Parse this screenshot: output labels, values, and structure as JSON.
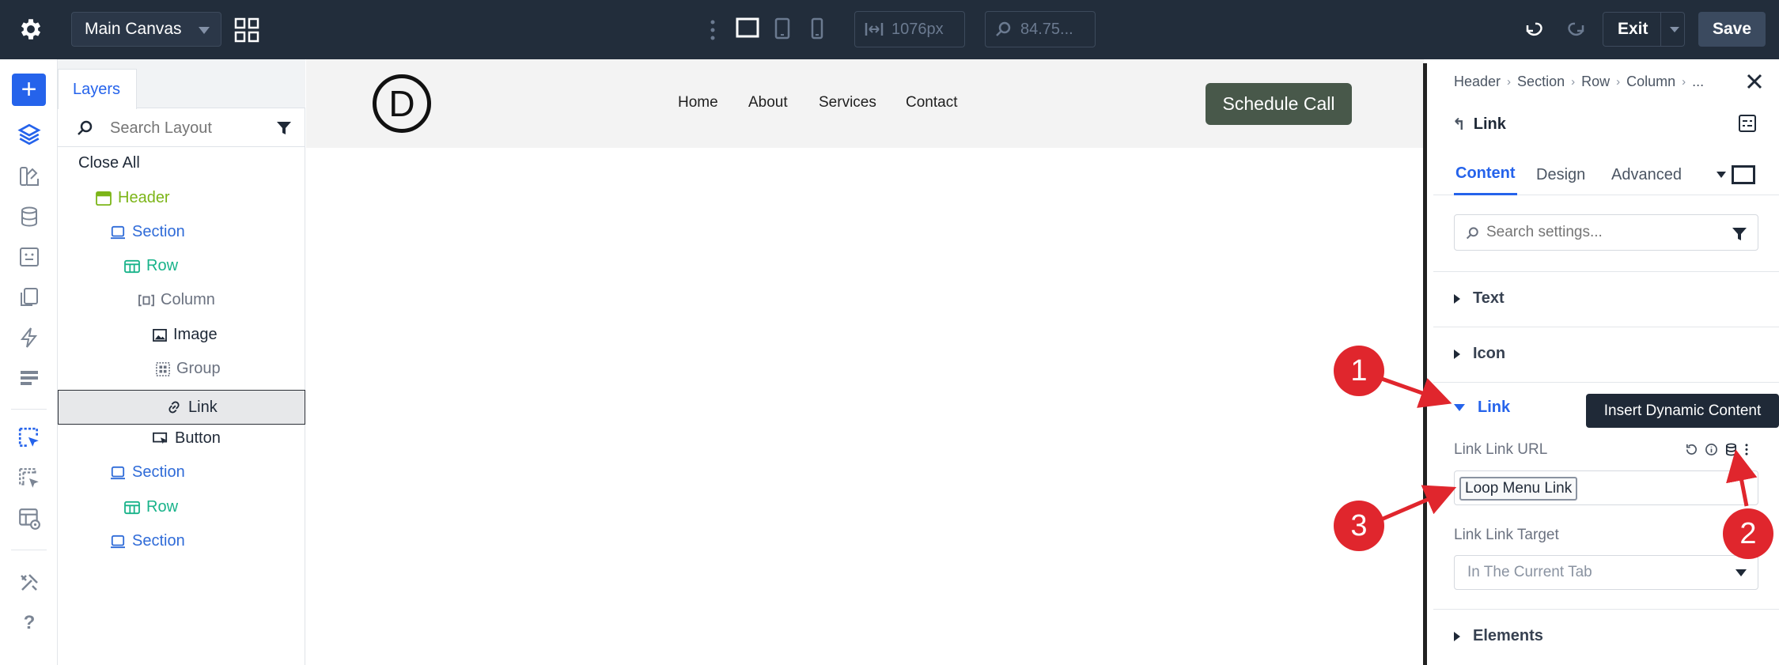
{
  "topbar": {
    "canvas_select": "Main Canvas",
    "width_value": "1076px",
    "zoom_value": "84.75...",
    "exit_label": "Exit",
    "save_label": "Save"
  },
  "layers": {
    "tab_label": "Layers",
    "search_placeholder": "Search Layout",
    "close_all": "Close All",
    "items": [
      {
        "label": "Header",
        "type": "header"
      },
      {
        "label": "Section",
        "type": "section"
      },
      {
        "label": "Row",
        "type": "row"
      },
      {
        "label": "Column",
        "type": "column"
      },
      {
        "label": "Image",
        "type": "image"
      },
      {
        "label": "Group",
        "type": "group"
      },
      {
        "label": "Link",
        "type": "link",
        "selected": true
      },
      {
        "label": "Button",
        "type": "button"
      },
      {
        "label": "Section",
        "type": "section"
      },
      {
        "label": "Row",
        "type": "row"
      },
      {
        "label": "Section",
        "type": "section"
      }
    ]
  },
  "canvas": {
    "logo_letter": "D",
    "nav": [
      "Home",
      "About",
      "Services",
      "Contact"
    ],
    "cta": "Schedule Call"
  },
  "settings": {
    "breadcrumb": [
      "Header",
      "Section",
      "Row",
      "Column",
      "..."
    ],
    "module_title": "Link",
    "tabs": [
      "Content",
      "Design",
      "Advanced"
    ],
    "search_placeholder": "Search settings...",
    "groups": {
      "text": "Text",
      "icon": "Icon",
      "link": "Link",
      "elements": "Elements"
    },
    "tooltip": "Insert Dynamic Content",
    "link_url_label": "Link Link URL",
    "link_url_value": "Loop Menu Link",
    "link_target_label": "Link Link Target",
    "link_target_value": "In The Current Tab"
  },
  "annotations": [
    "1",
    "2",
    "3"
  ],
  "colors": {
    "topbar_bg": "#222d3b",
    "accent": "#2563eb",
    "cta_bg": "#48584a",
    "annotation_red": "#e0262d"
  }
}
